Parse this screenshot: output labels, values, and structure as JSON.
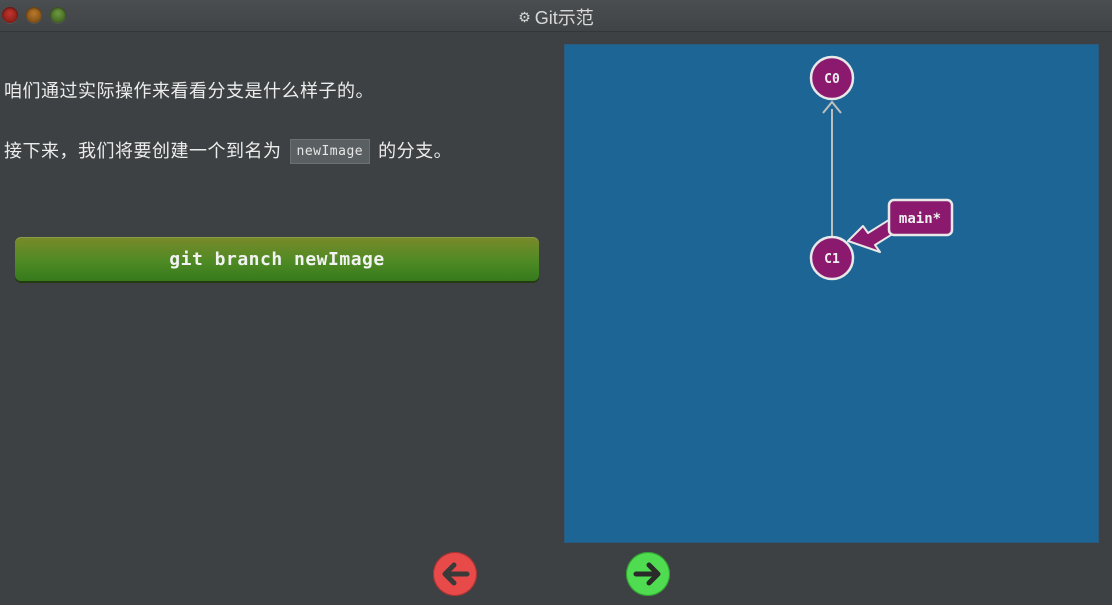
{
  "window": {
    "title": "Git示范",
    "gear_icon": "⚙"
  },
  "content": {
    "line1": "咱们通过实际操作来看看分支是什么样子的。",
    "line2_before": "接下来，我们将要创建一个到名为",
    "line2_code": "newImage",
    "line2_after": "的分支。",
    "command": "git branch newImage"
  },
  "graph": {
    "commits": [
      {
        "id": "C0",
        "label": "C0"
      },
      {
        "id": "C1",
        "label": "C1"
      }
    ],
    "branch": {
      "label": "main*"
    },
    "colors": {
      "background": "#1d6594",
      "commit_fill": "#8b1a6e",
      "commit_stroke": "#e8e8e8",
      "edge": "#bfbfbf",
      "branch_fill": "#8b1a6e"
    }
  },
  "nav": {
    "back_icon": "arrow-left-icon",
    "forward_icon": "arrow-right-icon",
    "back_color": "#e84a4a",
    "forward_color": "#4fdc50"
  }
}
